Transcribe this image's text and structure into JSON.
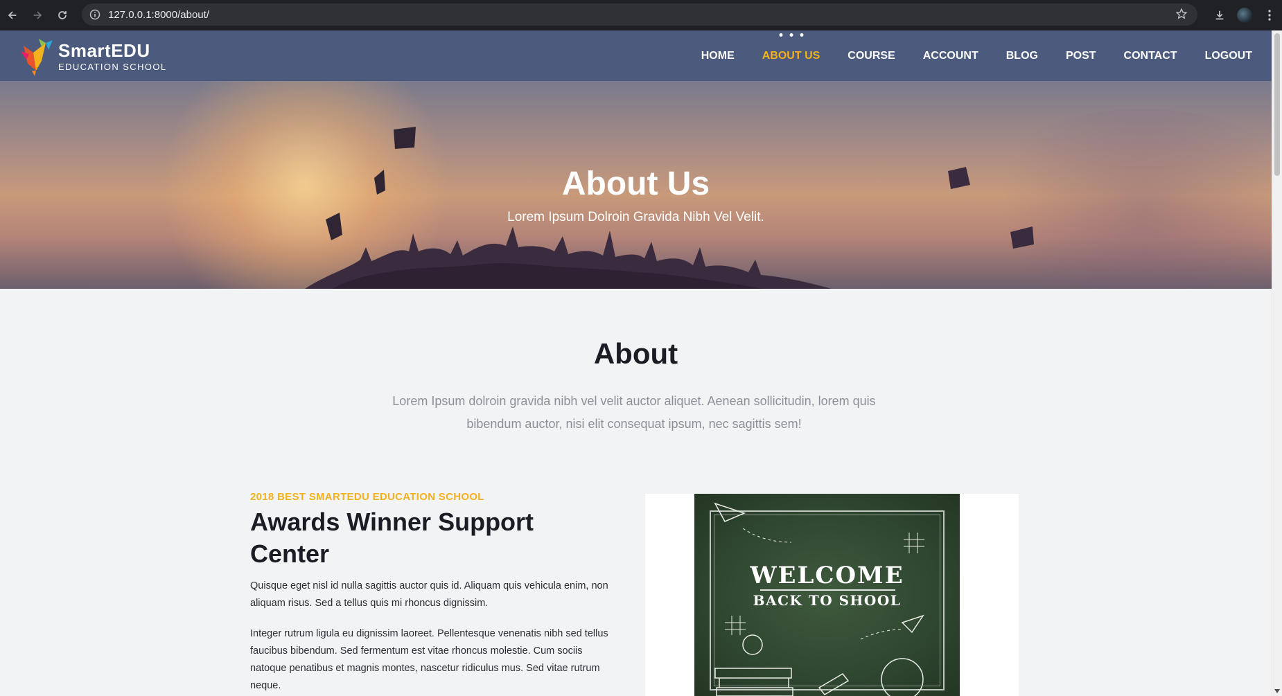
{
  "browser": {
    "url": "127.0.0.1:8000/about/"
  },
  "site": {
    "logo_title": "SmartEDU",
    "logo_subtitle": "EDUCATION SCHOOL",
    "menu": [
      {
        "label": "HOME",
        "active": false
      },
      {
        "label": "ABOUT US",
        "active": true
      },
      {
        "label": "COURSE",
        "active": false
      },
      {
        "label": "ACCOUNT",
        "active": false
      },
      {
        "label": "BLOG",
        "active": false
      },
      {
        "label": "POST",
        "active": false
      },
      {
        "label": "CONTACT",
        "active": false
      },
      {
        "label": "LOGOUT",
        "active": false
      }
    ],
    "accent_color": "#f3b11d",
    "header_color": "#4b5a7d"
  },
  "hero": {
    "title": "About Us",
    "subtitle": "Lorem Ipsum Dolroin Gravida Nibh Vel Velit."
  },
  "about": {
    "title": "About",
    "description": "Lorem Ipsum dolroin gravida nibh vel velit auctor aliquet. Aenean sollicitudin, lorem quis bibendum auctor, nisi elit consequat ipsum, nec sagittis sem!",
    "tagline": "2018 BEST SMARTEDU EDUCATION SCHOOL",
    "heading": "Awards Winner Support Center",
    "paragraph1": "Quisque eget nisl id nulla sagittis auctor quis id. Aliquam quis vehicula enim, non aliquam risus. Sed a tellus quis mi rhoncus dignissim.",
    "paragraph2": "Integer rutrum ligula eu dignissim laoreet. Pellentesque venenatis nibh sed tellus faucibus bibendum. Sed fermentum est vitae rhoncus molestie. Cum sociis natoque penatibus et magnis montes, nascetur ridiculus mus. Sed vitae rutrum neque.",
    "image_line1": "WELCOME",
    "image_line2": "BACK TO SHOOL"
  }
}
